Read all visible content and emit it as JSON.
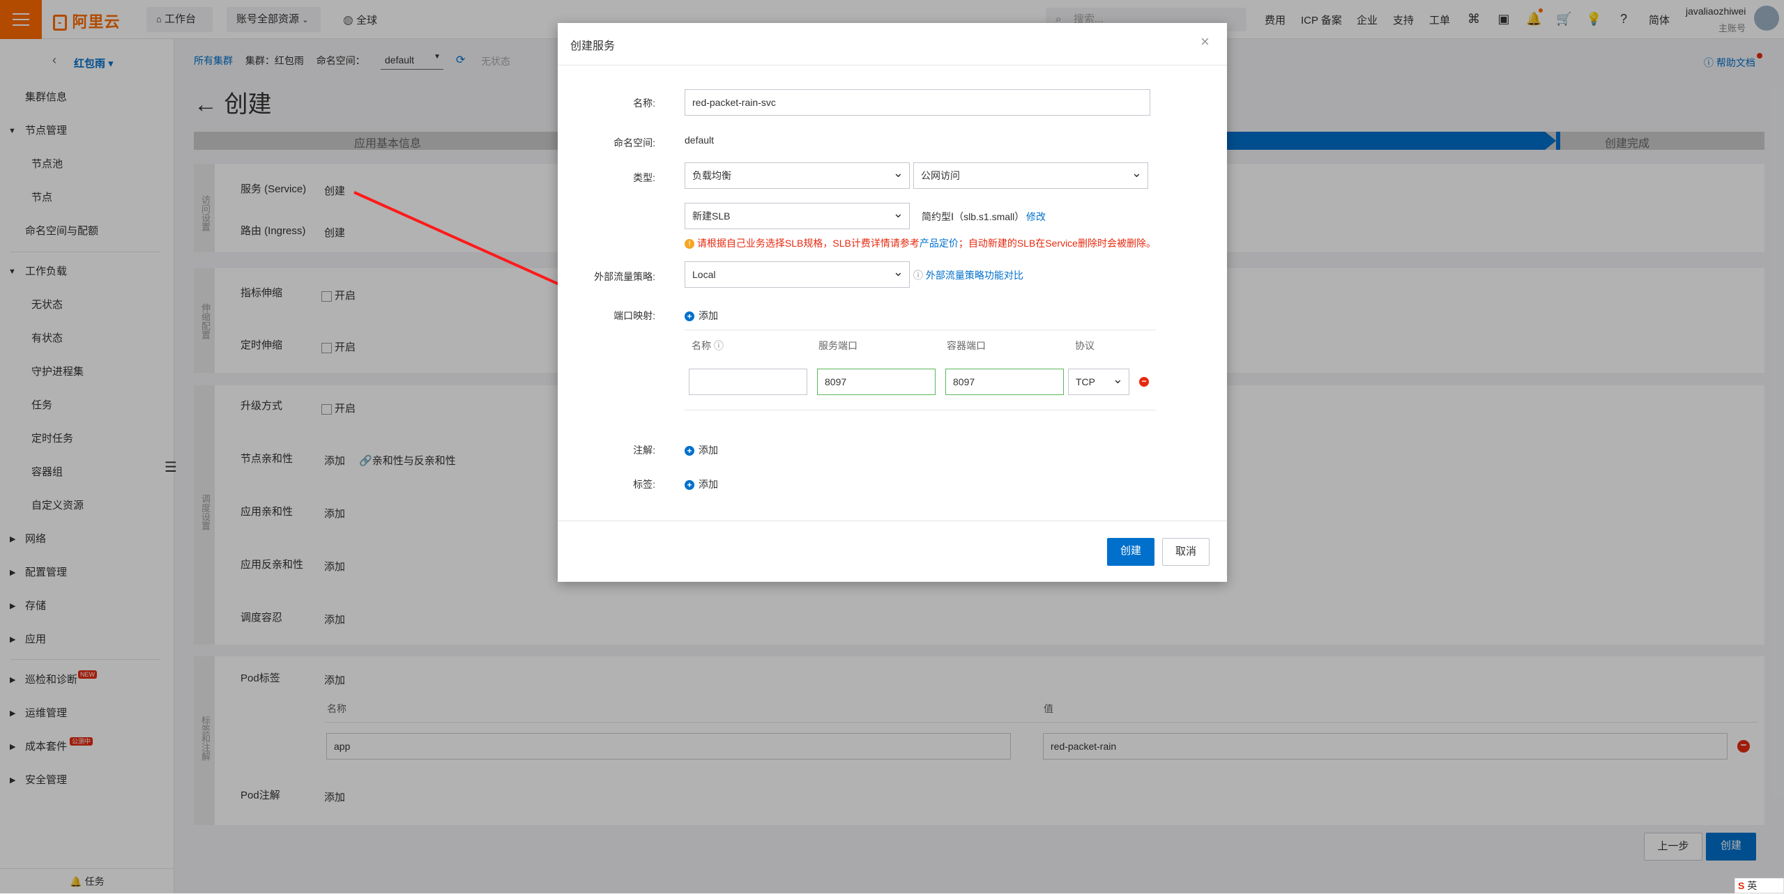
{
  "topbar": {
    "logo": "阿里云",
    "workbench": "工作台",
    "resources": "账号全部资源",
    "region": "全球",
    "search_placeholder": "搜索...",
    "links": [
      "费用",
      "ICP 备案",
      "企业",
      "支持",
      "工单"
    ],
    "lang": "简体",
    "username": "javaliaozhiwei",
    "account_type": "主账号"
  },
  "sidebar": {
    "cluster": "红包雨",
    "items": [
      "集群信息",
      "节点管理",
      "节点池",
      "节点",
      "命名空间与配额",
      "工作负载",
      "无状态",
      "有状态",
      "守护进程集",
      "任务",
      "定时任务",
      "容器组",
      "自定义资源",
      "网络",
      "配置管理",
      "存储",
      "应用",
      "巡检和诊断",
      "运维管理",
      "成本套件",
      "安全管理"
    ],
    "badge_new": "NEW",
    "badge_cost": "公测中",
    "footer": "任务"
  },
  "breadcrumb": {
    "all_clusters": "所有集群",
    "cluster": "集群：红包雨",
    "namespace_label": "命名空间：",
    "namespace_value": "default",
    "status": "无状态"
  },
  "page": {
    "title": "创建",
    "help": "帮助文档",
    "steps": [
      "应用基本信息",
      "创建完成"
    ],
    "access_section": "访问设置",
    "service_label": "服务 (Service)",
    "ingress_label": "路由 (Ingress)",
    "create_link": "创建",
    "scaling_section": "伸缩配置",
    "hpa_label": "指标伸缩",
    "cron_label": "定时伸缩",
    "enable": "开启",
    "schedule_section": "调度设置",
    "upgrade_label": "升级方式",
    "node_affinity_label": "节点亲和性",
    "add": "添加",
    "affinity_help": "亲和性与反亲和性",
    "app_affinity_label": "应用亲和性",
    "app_anti_affinity_label": "应用反亲和性",
    "toleration_label": "调度容忍",
    "labels_section": "标签和注解",
    "pod_labels": "Pod标签",
    "col_name": "名称",
    "col_value": "值",
    "pod_label_name": "app",
    "pod_label_value": "red-packet-rain",
    "pod_annotations": "Pod注解",
    "prev_btn": "上一步",
    "create_btn": "创建"
  },
  "modal": {
    "title": "创建服务",
    "name_label": "名称:",
    "name_value": "red-packet-rain-svc",
    "ns_label": "命名空间:",
    "ns_value": "default",
    "type_label": "类型:",
    "type_value": "负载均衡",
    "access_value": "公网访问",
    "slb_value": "新建SLB",
    "slb_spec": "简约型Ⅰ（slb.s1.small）",
    "modify": "修改",
    "warning_prefix": "请根据自己业务选择SLB规格，SLB计费详情请参考",
    "warning_link": "产品定价",
    "warning_suffix": "；自动新建的SLB在Service删除时会被删除。",
    "traffic_label": "外部流量策略:",
    "traffic_value": "Local",
    "traffic_help": "外部流量策略功能对比",
    "port_label": "端口映射:",
    "add": "添加",
    "col_name": "名称",
    "col_service_port": "服务端口",
    "col_container_port": "容器端口",
    "col_protocol": "协议",
    "service_port": "8097",
    "container_port": "8097",
    "protocol": "TCP",
    "annotation_label": "注解:",
    "label_label": "标签:",
    "create_btn": "创建",
    "cancel_btn": "取消"
  },
  "ime": "英"
}
